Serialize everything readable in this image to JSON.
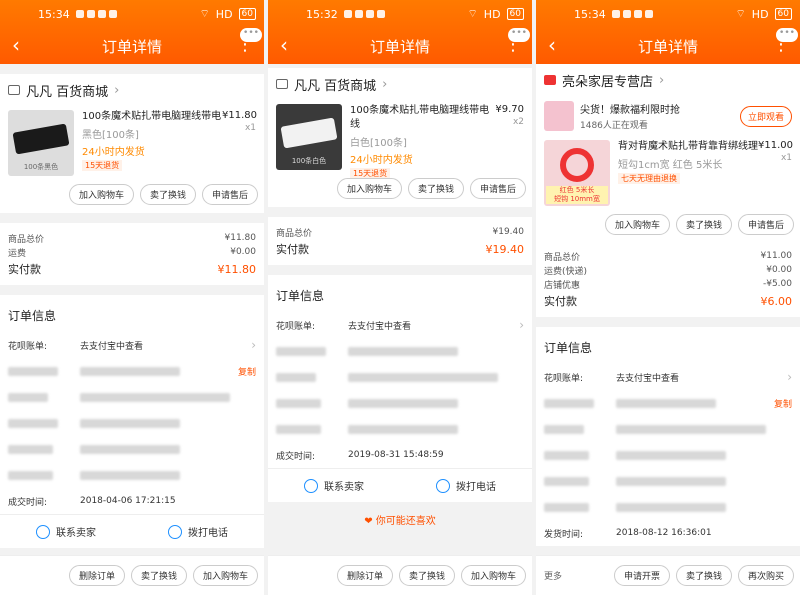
{
  "status_times": [
    "15:34",
    "15:32",
    "15:34"
  ],
  "status_right": "HD",
  "battery": "60",
  "nav_title": "订单详情",
  "panel1": {
    "shop": "凡凡 百货商城",
    "item_name": "100条魔术贴扎带电脑理线带电",
    "sku": "黑色[100条]",
    "ship": "24小时内发货",
    "tag": "15天退货",
    "price": "¥11.80",
    "qty": "x1",
    "thumb_caption": "100条黑色",
    "buttons": [
      "加入购物车",
      "卖了换钱",
      "申请售后"
    ],
    "sum_rows": [
      {
        "k": "商品总价",
        "v": "¥11.80"
      },
      {
        "k": "运费",
        "v": "¥0.00"
      }
    ],
    "paid_label": "实付款",
    "paid_value": "¥11.80",
    "orderinfo_title": "订单信息",
    "huabei_label": "花呗账单:",
    "huabei_value": "去支付宝中查看",
    "copy": "复制",
    "time_label": "成交时间:",
    "time_value": "2018-04-06 17:21:15",
    "contact_seller": "联系卖家",
    "call": "拨打电话",
    "bottom_buttons": [
      "删除订单",
      "卖了换钱",
      "加入购物车"
    ]
  },
  "panel2": {
    "shop": "凡凡 百货商城",
    "item_name": "100条魔术贴扎带电脑理线带电线",
    "sku": "白色[100条]",
    "ship": "24小时内发货",
    "tag": "15天退货",
    "price": "¥9.70",
    "qty": "x2",
    "thumb_caption": "100条白色",
    "buttons": [
      "加入购物车",
      "卖了换钱",
      "申请售后"
    ],
    "sum_rows": [
      {
        "k": "商品总价",
        "v": "¥19.40"
      }
    ],
    "paid_label": "实付款",
    "paid_value": "¥19.40",
    "orderinfo_title": "订单信息",
    "huabei_label": "花呗账单:",
    "huabei_value": "去支付宝中查看",
    "time_label": "成交时间:",
    "time_value": "2019-08-31 15:48:59",
    "contact_seller": "联系卖家",
    "call": "拨打电话",
    "guess": "你可能还喜欢",
    "bottom_buttons": [
      "删除订单",
      "卖了换钱",
      "加入购物车"
    ]
  },
  "panel3": {
    "shop": "亮朵家居专营店",
    "promo_title": "尖货！爆款福利限时抢",
    "promo_sub": "1486人正在观看",
    "promo_btn": "立即观看",
    "item_name": "背对背魔术贴扎带背靠背绑线理",
    "sku": "短勾1cm宽 红色 5米长",
    "tag": "七天无理由退换",
    "price": "¥11.00",
    "qty": "x1",
    "thumb_caption_1": "红色 5米长",
    "thumb_caption_2": "短钩 10mm宽",
    "buttons": [
      "加入购物车",
      "卖了换钱",
      "申请售后"
    ],
    "sum_rows": [
      {
        "k": "商品总价",
        "v": "¥11.00"
      },
      {
        "k": "运费(快递)",
        "v": "¥0.00"
      },
      {
        "k": "店铺优惠",
        "v": "-¥5.00"
      }
    ],
    "paid_label": "实付款",
    "paid_value": "¥6.00",
    "orderinfo_title": "订单信息",
    "huabei_label": "花呗账单:",
    "huabei_value": "去支付宝中查看",
    "copy": "复制",
    "time_label": "发货时间:",
    "time_value": "2018-08-12 16:36:01",
    "more": "更多",
    "bottom_buttons": [
      "申请开票",
      "卖了换钱",
      "再次购买"
    ]
  }
}
